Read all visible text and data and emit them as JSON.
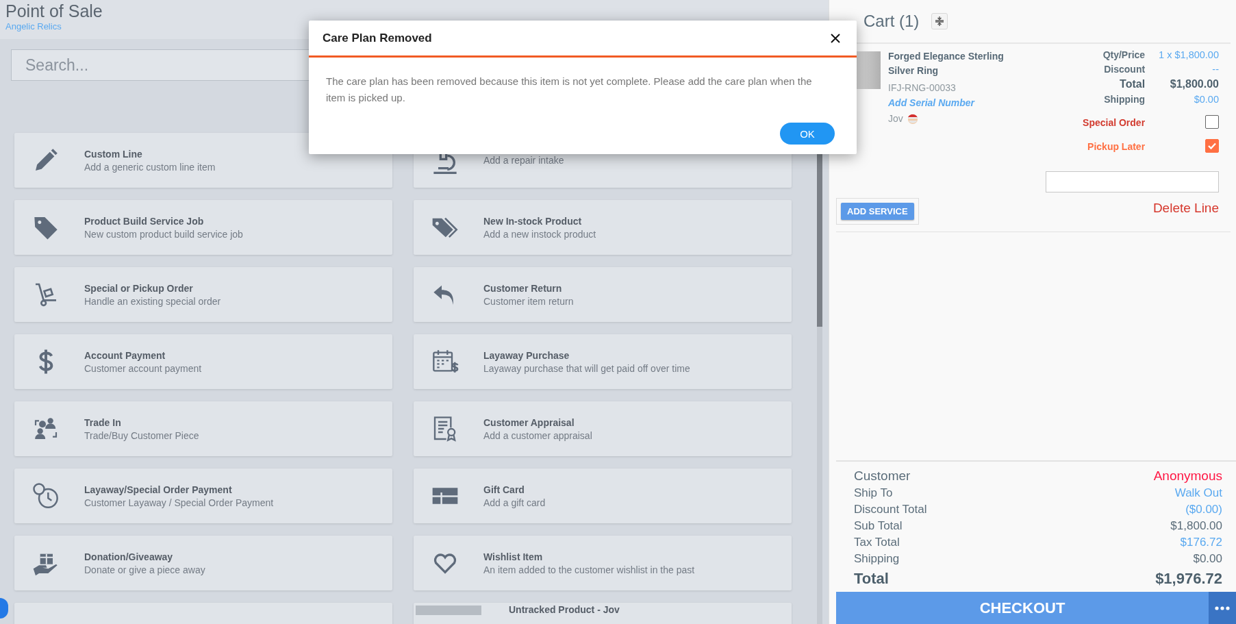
{
  "header": {
    "title": "Point of Sale",
    "subtitle": "Angelic Relics"
  },
  "search": {
    "placeholder": "Search..."
  },
  "tiles": [
    {
      "kind": "action",
      "title": "Custom Line",
      "subtitle": "Add a generic custom line item"
    },
    {
      "kind": "action",
      "subtitle": "Add a repair intake"
    },
    {
      "kind": "action",
      "title": "Product Build Service Job",
      "subtitle": "New custom product build service job"
    },
    {
      "kind": "action",
      "title": "New In-stock Product",
      "subtitle": "Add a new instock product"
    },
    {
      "kind": "action",
      "title": "Special or Pickup Order",
      "subtitle": "Handle an existing special order"
    },
    {
      "kind": "action",
      "title": "Customer Return",
      "subtitle": "Customer item return"
    },
    {
      "kind": "action",
      "title": "Account Payment",
      "subtitle": "Customer account payment"
    },
    {
      "kind": "action",
      "title": "Layaway Purchase",
      "subtitle": "Layaway purchase that will get paid off over time"
    },
    {
      "kind": "action",
      "title": "Trade In",
      "subtitle": "Trade/Buy Customer Piece"
    },
    {
      "kind": "action",
      "title": "Customer Appraisal",
      "subtitle": "Add a customer appraisal"
    },
    {
      "kind": "action",
      "title": "Layaway/Special Order Payment",
      "subtitle": "Customer Layaway / Special Order Payment"
    },
    {
      "kind": "action",
      "title": "Gift Card",
      "subtitle": "Add a gift card"
    },
    {
      "kind": "action",
      "title": "Donation/Giveaway",
      "subtitle": "Donate or give a piece away"
    },
    {
      "kind": "action",
      "title": "Wishlist Item",
      "subtitle": "An item added to the customer wishlist in the past"
    },
    {
      "kind": "blank"
    },
    {
      "kind": "product",
      "title": "Untracked Product - Jov"
    }
  ],
  "dialog": {
    "title": "Care Plan Removed",
    "message": "The care plan has been removed because this item is not yet complete. Please add the care plan when the item is picked up.",
    "ok": "OK"
  },
  "cart": {
    "title": "Cart (1)",
    "item": {
      "name": "Forged Elegance Sterling Silver Ring",
      "sku": "IFJ-RNG-00033",
      "serial_link": "Add Serial Number",
      "salesperson": "Jov",
      "fields": [
        {
          "label": "Qty/Price",
          "value": "1 x $1,800.00",
          "kind": "link"
        },
        {
          "label": "Discount",
          "value": "--",
          "kind": "link"
        },
        {
          "label": "Total",
          "value": "$1,800.00",
          "kind": "total"
        },
        {
          "label": "Shipping",
          "value": "$0.00",
          "kind": "link"
        }
      ],
      "flags": [
        {
          "label": "Special Order",
          "checked": false
        },
        {
          "label": "Pickup Later",
          "checked": true
        }
      ],
      "add_service": "ADD SERVICE",
      "delete": "Delete Line"
    },
    "summary": [
      {
        "label": "Customer",
        "value": "Anonymous",
        "kind": "customer"
      },
      {
        "label": "Ship To",
        "value": "Walk Out",
        "kind": "link"
      },
      {
        "label": "Discount Total",
        "value": "($0.00)",
        "kind": "link"
      },
      {
        "label": "Sub Total",
        "value": "$1,800.00",
        "kind": "plain"
      },
      {
        "label": "Tax Total",
        "value": "$176.72",
        "kind": "link"
      },
      {
        "label": "Shipping",
        "value": "$0.00",
        "kind": "plain"
      },
      {
        "label": "Total",
        "value": "$1,976.72",
        "kind": "total"
      }
    ],
    "checkout": "CHECKOUT"
  }
}
